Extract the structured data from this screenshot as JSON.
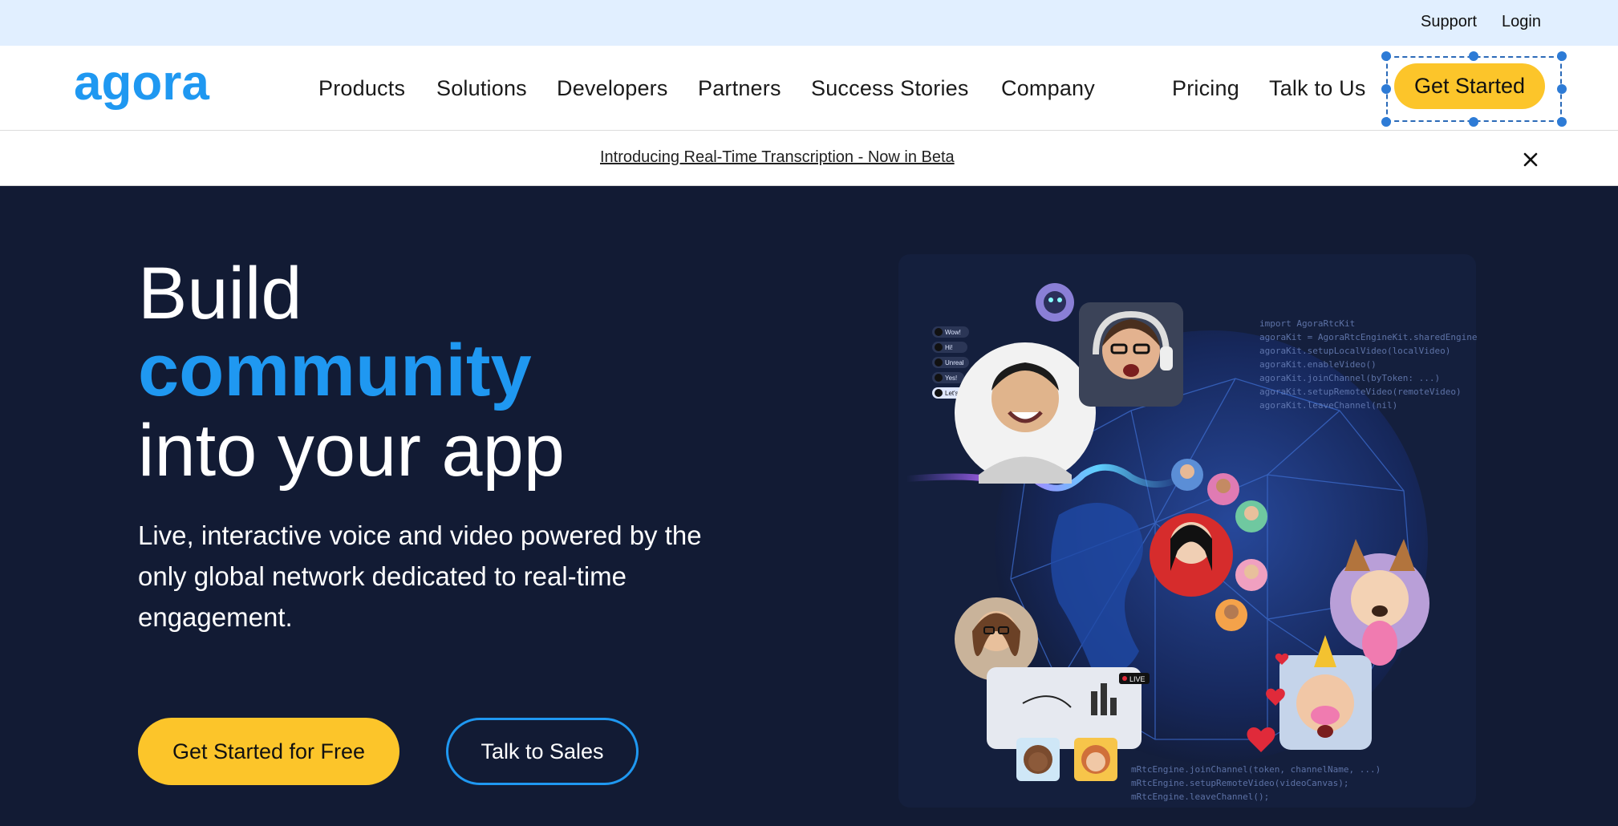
{
  "utility": {
    "support": "Support",
    "login": "Login"
  },
  "nav": {
    "logo": "agora",
    "items": [
      "Products",
      "Solutions",
      "Developers",
      "Partners",
      "Success Stories",
      "Company"
    ],
    "pricing": "Pricing",
    "talk": "Talk to Us",
    "cta": "Get Started"
  },
  "announcement": {
    "text": "Introducing Real-Time Transcription - Now in Beta"
  },
  "hero": {
    "line1": "Build",
    "line2": "community",
    "line3": "into your app",
    "subtitle": "Live, interactive voice and video powered by the only global network dedicated to real-time engagement.",
    "primary_cta": "Get Started for Free",
    "secondary_cta": "Talk to Sales"
  },
  "illustration": {
    "chat_bubbles": [
      "Wow!",
      "Hi!",
      "Unreal",
      "Yes!",
      "Let's go!"
    ],
    "live_badge": "LIVE",
    "code_lines": [
      "import AgoraRtcKit",
      "agoraKit = AgoraRtcEngineKit.sharedEngine",
      "agoraKit.setupLocalVideo(localVideo)",
      "agoraKit.enableVideo()",
      "agoraKit.joinChannel(byToken: ...)",
      "agoraKit.setupRemoteVideo(remoteVideo)",
      "agoraKit.leaveChannel(nil)"
    ],
    "code_lines_bottom": [
      "mRtcEngine.joinChannel(token, channelName, ...)",
      "mRtcEngine.setupRemoteVideo(videoCanvas);",
      "mRtcEngine.leaveChannel();"
    ]
  },
  "colors": {
    "accent_blue": "#1f98f1",
    "cta_yellow": "#fcc52a",
    "hero_bg": "#121b34",
    "utility_bg": "#e1efff"
  }
}
